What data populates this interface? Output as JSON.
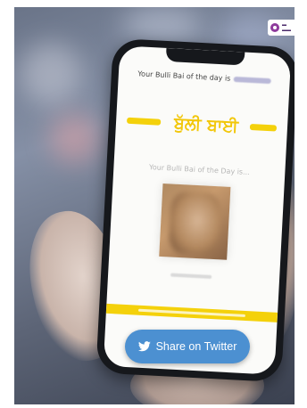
{
  "screen": {
    "header_prefix": "Your Bulli Bai of the day is",
    "title": "ਬੁੱਲੀ ਬਾਈ",
    "subtitle": "Your Bulli Bai of the Day is..."
  },
  "share_button": {
    "label": "Share on Twitter",
    "icon": "twitter-bird-icon"
  },
  "logo": {
    "icon": "outlook-logo-icon"
  },
  "colors": {
    "accent_yellow": "#f4d10b",
    "twitter_blue": "#4c90d1"
  }
}
